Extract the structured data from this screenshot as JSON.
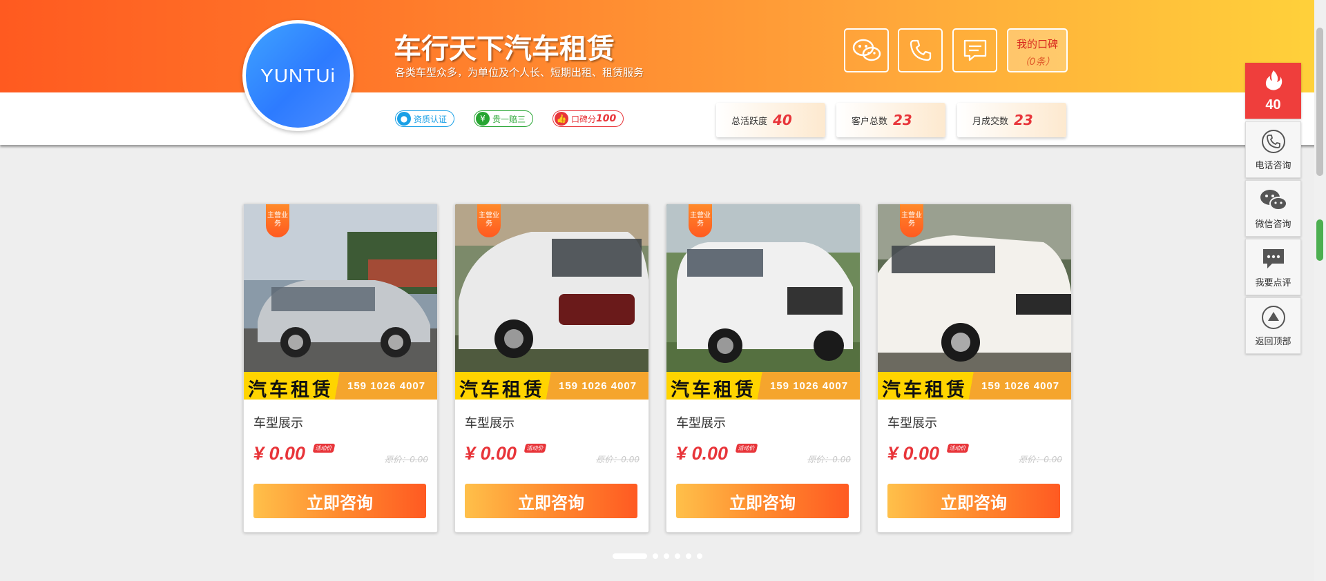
{
  "header": {
    "logo_text": "YUNTUi",
    "title": "车行天下汽车租赁",
    "subtitle": "各类车型众多，为单位及个人长、短期出租、租赁服务",
    "icons": [
      "wechat-icon",
      "phone-icon",
      "message-icon"
    ],
    "review": {
      "label": "我的口碑",
      "count": "（0条）"
    },
    "badges": [
      {
        "icon": "user-icon",
        "label": "资质认证",
        "color": "#1aa0e6"
      },
      {
        "icon": "yen-icon",
        "label": "贵一赔三",
        "color": "#27a532"
      },
      {
        "icon": "thumb-icon",
        "label": "口碑分",
        "value": "100",
        "color": "#e8353a"
      }
    ],
    "stats": [
      {
        "label": "总活跃度",
        "value": "40"
      },
      {
        "label": "客户总数",
        "value": "23"
      },
      {
        "label": "月成交数",
        "value": "23"
      }
    ]
  },
  "cards": [
    {
      "ribbon": "主营业务",
      "banner_title": "汽车租赁",
      "banner_phone": "159 1026 4007",
      "name": "车型展示",
      "price": "¥ 0.00",
      "tag": "活动价",
      "orig": "原价：0.00",
      "button": "立即咨询"
    },
    {
      "ribbon": "主营业务",
      "banner_title": "汽车租赁",
      "banner_phone": "159 1026 4007",
      "name": "车型展示",
      "price": "¥ 0.00",
      "tag": "活动价",
      "orig": "原价：0.00",
      "button": "立即咨询"
    },
    {
      "ribbon": "主营业务",
      "banner_title": "汽车租赁",
      "banner_phone": "159 1026 4007",
      "name": "车型展示",
      "price": "¥ 0.00",
      "tag": "活动价",
      "orig": "原价：0.00",
      "button": "立即咨询"
    },
    {
      "ribbon": "主营业务",
      "banner_title": "汽车租赁",
      "banner_phone": "159 1026 4007",
      "name": "车型展示",
      "price": "¥ 0.00",
      "tag": "活动价",
      "orig": "原价：0.00",
      "button": "立即咨询"
    }
  ],
  "carousel": {
    "pages": 6,
    "active": 1
  },
  "sidebar": {
    "hot_value": "40",
    "items": [
      {
        "icon": "phone-icon",
        "label": "电话咨询"
      },
      {
        "icon": "wechat-icon",
        "label": "微信咨询"
      },
      {
        "icon": "comment-icon",
        "label": "我要点评"
      },
      {
        "icon": "back-to-top-icon",
        "label": "返回顶部"
      }
    ]
  },
  "colors": {
    "accent": "#ff5a20",
    "price": "#e8353a",
    "hot": "#ef3e3c"
  }
}
